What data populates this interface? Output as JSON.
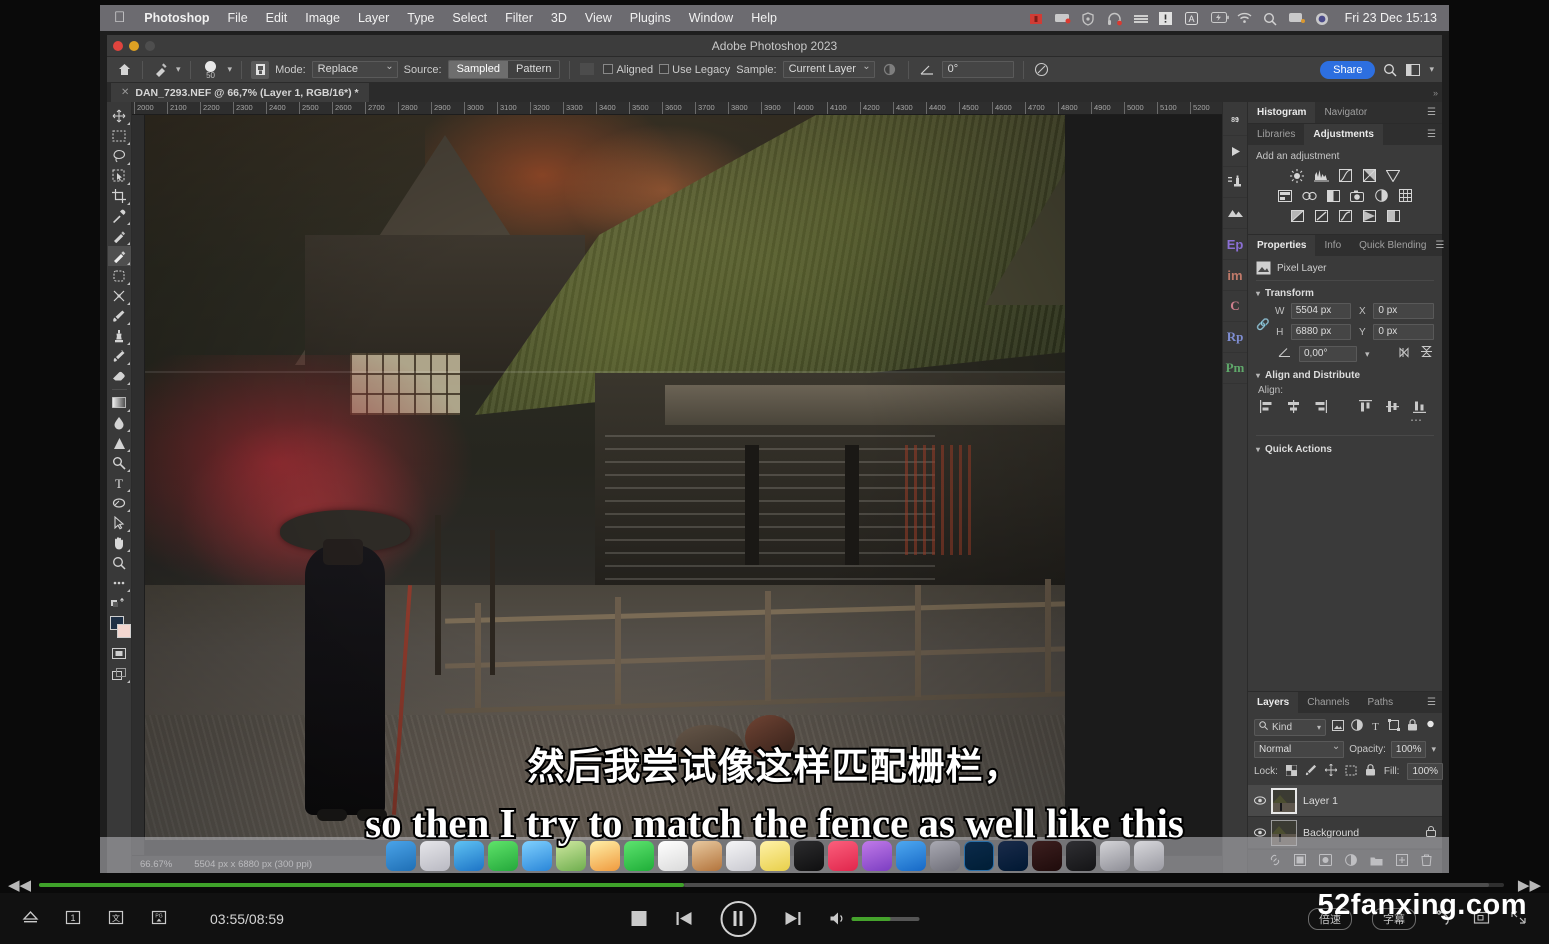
{
  "macos": {
    "apple_icon": "apple-logo-icon",
    "menus": [
      "Photoshop",
      "File",
      "Edit",
      "Image",
      "Layer",
      "Type",
      "Select",
      "Filter",
      "3D",
      "View",
      "Plugins",
      "Window",
      "Help"
    ],
    "tray_icons": [
      "record-stop-icon",
      "screen-recorder-icon",
      "shield-icon",
      "headphone-icon",
      "keyboard-icon",
      "warning-icon",
      "input-source-a-icon",
      "battery-charging-icon",
      "wifi-icon",
      "spotlight-search-icon",
      "control-center-icon",
      "siri-icon"
    ],
    "clock": "Fri 23 Dec  15:13"
  },
  "photoshop": {
    "window_title": "Adobe Photoshop 2023",
    "options_bar": {
      "home_icon": "home-icon",
      "tool_preset_icon": "healing-brush-icon",
      "brush_size": "50",
      "pressure_icon": "tablet-pressure-icon",
      "mode_label": "Mode:",
      "mode_value": "Replace",
      "source_label": "Source:",
      "source_options": [
        "Sampled",
        "Pattern"
      ],
      "source_selected": "Sampled",
      "aligned_label": "Aligned",
      "use_legacy_label": "Use Legacy",
      "sample_label": "Sample:",
      "sample_value": "Current Layer",
      "angle_value": "0°",
      "airbrush_icon": "airbrush-icon",
      "share_label": "Share",
      "search_icon": "search-icon",
      "workspace_icon": "workspace-switcher-icon"
    },
    "document_tab": {
      "close_icon": "close-icon",
      "title": "DAN_7293.NEF @ 66,7% (Layer 1, RGB/16*) *"
    },
    "tools": [
      {
        "name": "move-tool",
        "selected": false
      },
      {
        "name": "rectangular-marquee-tool",
        "selected": false
      },
      {
        "name": "lasso-tool",
        "selected": false
      },
      {
        "name": "object-selection-tool",
        "selected": false
      },
      {
        "name": "crop-tool",
        "selected": false
      },
      {
        "name": "eyedropper-tool",
        "selected": false
      },
      {
        "name": "spot-healing-brush-tool",
        "selected": false
      },
      {
        "name": "healing-brush-tool",
        "selected": true
      },
      {
        "name": "patch-tool",
        "selected": false
      },
      {
        "name": "content-aware-move-tool",
        "selected": false
      },
      {
        "name": "brush-tool",
        "selected": false
      },
      {
        "name": "clone-stamp-tool",
        "selected": false
      },
      {
        "name": "history-brush-tool",
        "selected": false
      },
      {
        "name": "eraser-tool",
        "selected": false
      },
      {
        "name": "gradient-tool",
        "selected": false
      },
      {
        "name": "blur-tool",
        "selected": false
      },
      {
        "name": "dodge-tool",
        "selected": false
      },
      {
        "name": "pen-tool",
        "selected": false
      },
      {
        "name": "type-tool",
        "selected": false
      },
      {
        "name": "path-selection-tool",
        "selected": false
      },
      {
        "name": "direct-selection-tool",
        "selected": false
      },
      {
        "name": "hand-tool",
        "selected": false
      },
      {
        "name": "zoom-tool",
        "selected": false
      },
      {
        "name": "edit-toolbar-tool",
        "selected": false
      }
    ],
    "ruler": {
      "start": 2000,
      "step": 100,
      "count": 38,
      "unit": "px"
    },
    "status_bar": {
      "zoom": "66.67%",
      "dimensions": "5504 px x 6880 px (300 ppi)"
    },
    "right_rail": [
      "discover-icon",
      "play-icon",
      "presets-icon",
      "landscape-icon",
      "Ep",
      "im",
      "C",
      "Rp",
      "Pm"
    ],
    "panels": {
      "histogram_group": {
        "tabs": [
          "Histogram",
          "Navigator"
        ],
        "active": "Histogram",
        "menu_icon": "panel-menu-icon"
      },
      "adjustments_group": {
        "tabs": [
          "Libraries",
          "Adjustments"
        ],
        "active": "Adjustments",
        "menu_icon": "panel-menu-icon",
        "heading": "Add an adjustment",
        "row1": [
          "brightness-contrast-icon",
          "levels-icon",
          "curves-icon",
          "exposure-icon",
          "vibrance-icon"
        ],
        "row2": [
          "hue-saturation-icon",
          "color-balance-icon",
          "black-white-icon",
          "photo-filter-icon",
          "channel-mixer-icon",
          "color-lookup-icon"
        ],
        "row3": [
          "invert-icon",
          "posterize-icon",
          "threshold-icon",
          "gradient-map-icon",
          "selective-color-icon"
        ]
      },
      "properties_group": {
        "tabs": [
          "Properties",
          "Info",
          "Quick Blending"
        ],
        "active": "Properties",
        "menu_icon": "panel-menu-icon",
        "layer_kind_icon": "pixel-layer-icon",
        "layer_kind": "Pixel Layer",
        "transform": {
          "title": "Transform",
          "link_icon": "link-aspect-ratio-icon",
          "w_label": "W",
          "w_value": "5504 px",
          "x_label": "X",
          "x_value": "0 px",
          "h_label": "H",
          "h_value": "6880 px",
          "y_label": "Y",
          "y_value": "0 px",
          "angle_icon": "angle-icon",
          "angle_value": "0,00°",
          "flip_h_icon": "flip-horizontal-icon",
          "flip_v_icon": "flip-vertical-icon"
        },
        "align": {
          "title": "Align and Distribute",
          "label": "Align:",
          "icons": [
            "align-left-icon",
            "align-center-horizontal-icon",
            "align-right-icon",
            "align-top-icon",
            "align-middle-vertical-icon",
            "align-bottom-icon"
          ],
          "more_icon": "more-options-icon"
        },
        "quick_actions": {
          "title": "Quick Actions"
        }
      },
      "layers_group": {
        "tabs": [
          "Layers",
          "Channels",
          "Paths"
        ],
        "active": "Layers",
        "menu_icon": "panel-menu-icon",
        "filter": {
          "search_icon": "search-icon",
          "kind_label": "Kind",
          "filter_icons": [
            "filter-pixel-icon",
            "filter-adjustment-icon",
            "filter-type-icon",
            "filter-shape-icon",
            "filter-smart-object-icon"
          ],
          "toggle_icon": "filter-toggle-icon"
        },
        "blend_mode": "Normal",
        "opacity_label": "Opacity:",
        "opacity_value": "100%",
        "lock_label": "Lock:",
        "lock_icons": [
          "lock-transparent-pixels-icon",
          "lock-image-pixels-icon",
          "lock-position-icon",
          "lock-artboard-nesting-icon",
          "lock-all-icon"
        ],
        "fill_label": "Fill:",
        "fill_value": "100%",
        "layers": [
          {
            "name": "Layer 1",
            "visible": true,
            "selected": true,
            "locked": false,
            "eye_icon": "eye-icon"
          },
          {
            "name": "Background",
            "visible": true,
            "selected": false,
            "locked": true,
            "eye_icon": "eye-icon",
            "lock_icon": "lock-icon"
          }
        ],
        "bottom_icons": [
          "link-layers-icon",
          "layer-style-icon",
          "layer-mask-icon",
          "new-fill-adjustment-icon",
          "new-group-icon",
          "new-layer-icon",
          "delete-layer-icon"
        ]
      }
    },
    "dock_apps": [
      "finder-icon",
      "launchpad-icon",
      "safari-icon",
      "messages-icon",
      "mail-icon",
      "maps-icon",
      "photos-icon",
      "facetime-icon",
      "calendar-icon",
      "contacts-icon",
      "reminders-icon",
      "notes-icon",
      "tv-icon",
      "music-icon",
      "podcasts-icon",
      "appstore-icon",
      "settings-icon",
      "photoshop-icon",
      "lightroom-icon",
      "bridge-icon",
      "capture-one-icon",
      "downloads-icon",
      "trash-icon"
    ]
  },
  "subtitles": {
    "chinese": "然后我尝试像这样匹配栅栏，",
    "english": "so then I try to match the fence as well like this"
  },
  "player": {
    "rewind_icon": "rewind-icon",
    "fast_forward_icon": "fast-forward-icon",
    "progress_percent": 44,
    "loaded_percent": 99,
    "eject_icon": "eject-icon",
    "chapter_icon": "chapter-1-icon",
    "subtitle_track_icon": "subtitle-track-icon",
    "audio_track_icon": "audio-track-icon",
    "time": "03:55/08:59",
    "stop_icon": "stop-icon",
    "previous_icon": "previous-icon",
    "pause_icon": "pause-icon",
    "next_icon": "next-icon",
    "volume_icon": "volume-icon",
    "volume_percent": 58,
    "speed_label": "倍速",
    "subtitle_label": "字幕",
    "snapshot_icon": "snapshot-icon",
    "screenshot_icon": "screenshot-icon",
    "fullscreen_icon": "fullscreen-icon"
  },
  "watermark": "52fanxing.com"
}
